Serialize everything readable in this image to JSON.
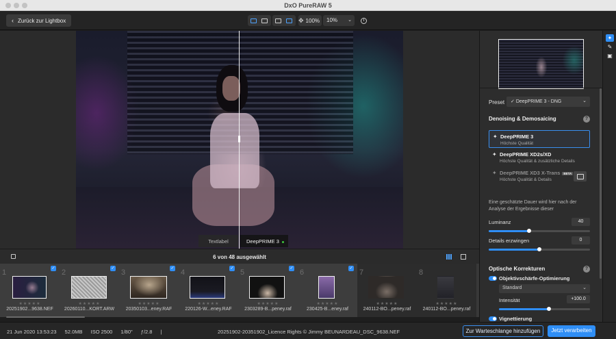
{
  "window": {
    "title": "DxO PureRAW 5"
  },
  "toolbar": {
    "back_label": "Zurück zur Lightbox",
    "zoom_value": "100%",
    "zoom_select": "10%"
  },
  "viewer": {
    "left_label": "Textlabel",
    "right_label": "DeepPRIME 3"
  },
  "filmstrip": {
    "count_text": "6 von 48 ausgewählt",
    "items": [
      {
        "num": "1",
        "name": "20251902...9638.NEF",
        "stars": "★★★★★",
        "selected": true
      },
      {
        "num": "2",
        "name": "20260110...KORT.ARW",
        "stars": "★★★★★",
        "selected": true
      },
      {
        "num": "3",
        "name": "20350103...eney.RAF",
        "stars": "★★★★★",
        "selected": true
      },
      {
        "num": "4",
        "name": "220126-W...eney.RAF",
        "stars": "★★★★★",
        "selected": true
      },
      {
        "num": "5",
        "name": "2303289-B...peney.raf",
        "stars": "★★★★★",
        "selected": true
      },
      {
        "num": "6",
        "name": "230425-B...eney.raf",
        "stars": "★★★★★",
        "selected": true
      },
      {
        "num": "7",
        "name": "240112-BO...peney.raf",
        "stars": "★★★★★",
        "selected": false
      },
      {
        "num": "8",
        "name": "240112-BO...peney.raf",
        "stars": "★★★★★",
        "selected": false
      }
    ]
  },
  "status": {
    "date": "21 Jun 2020 13:53:23",
    "size": "52.0MB",
    "iso": "ISO 2500",
    "shutter": "1/80\"",
    "aperture": "ƒ/2.8",
    "sep": "|",
    "copyright": "20251902-20351902_Licence Rights © Jimmy BEUNARDEAU_DSC_9638.NEF",
    "queue_label": "Zur Warteschlange hinzufügen",
    "process_label": "Jetzt verarbeiten"
  },
  "panel": {
    "preset_label": "Preset",
    "preset_value": "DeepPRIME 3 - DNG",
    "denoise_title": "Denoising & Demosaicing",
    "options": [
      {
        "title": "DeepPRIME 3",
        "subtitle": "Höchste Qualität"
      },
      {
        "title": "DeepPRIME XD2s/XD",
        "subtitle": "Höchste Qualität & zusätzliche Details"
      },
      {
        "title": "DeepPRIME XD3 X-Trans",
        "subtitle": "Höchste Qualität & Details",
        "badge": "BETA"
      }
    ],
    "estimate_text": "Eine geschätzte Dauer wird hier nach der Analyse der Ergebnisse dieser",
    "luminance_label": "Luminanz",
    "luminance_value": "40",
    "luminance_level": 0.4,
    "details_label": "Details erzwingen",
    "details_value": "0",
    "details_level": 0.5,
    "optical_title": "Optische Korrekturen",
    "lens_label": "Objektivschärfe-Optimierung",
    "lens_select": "Standard",
    "intensity_label": "Intensität",
    "intensity_value": "+100.0",
    "intensity_level": 0.55,
    "vignetting_label": "Vignettierung"
  },
  "colors": {
    "accent": "#2f8ef5",
    "selection_border": "#3a8ff0"
  }
}
